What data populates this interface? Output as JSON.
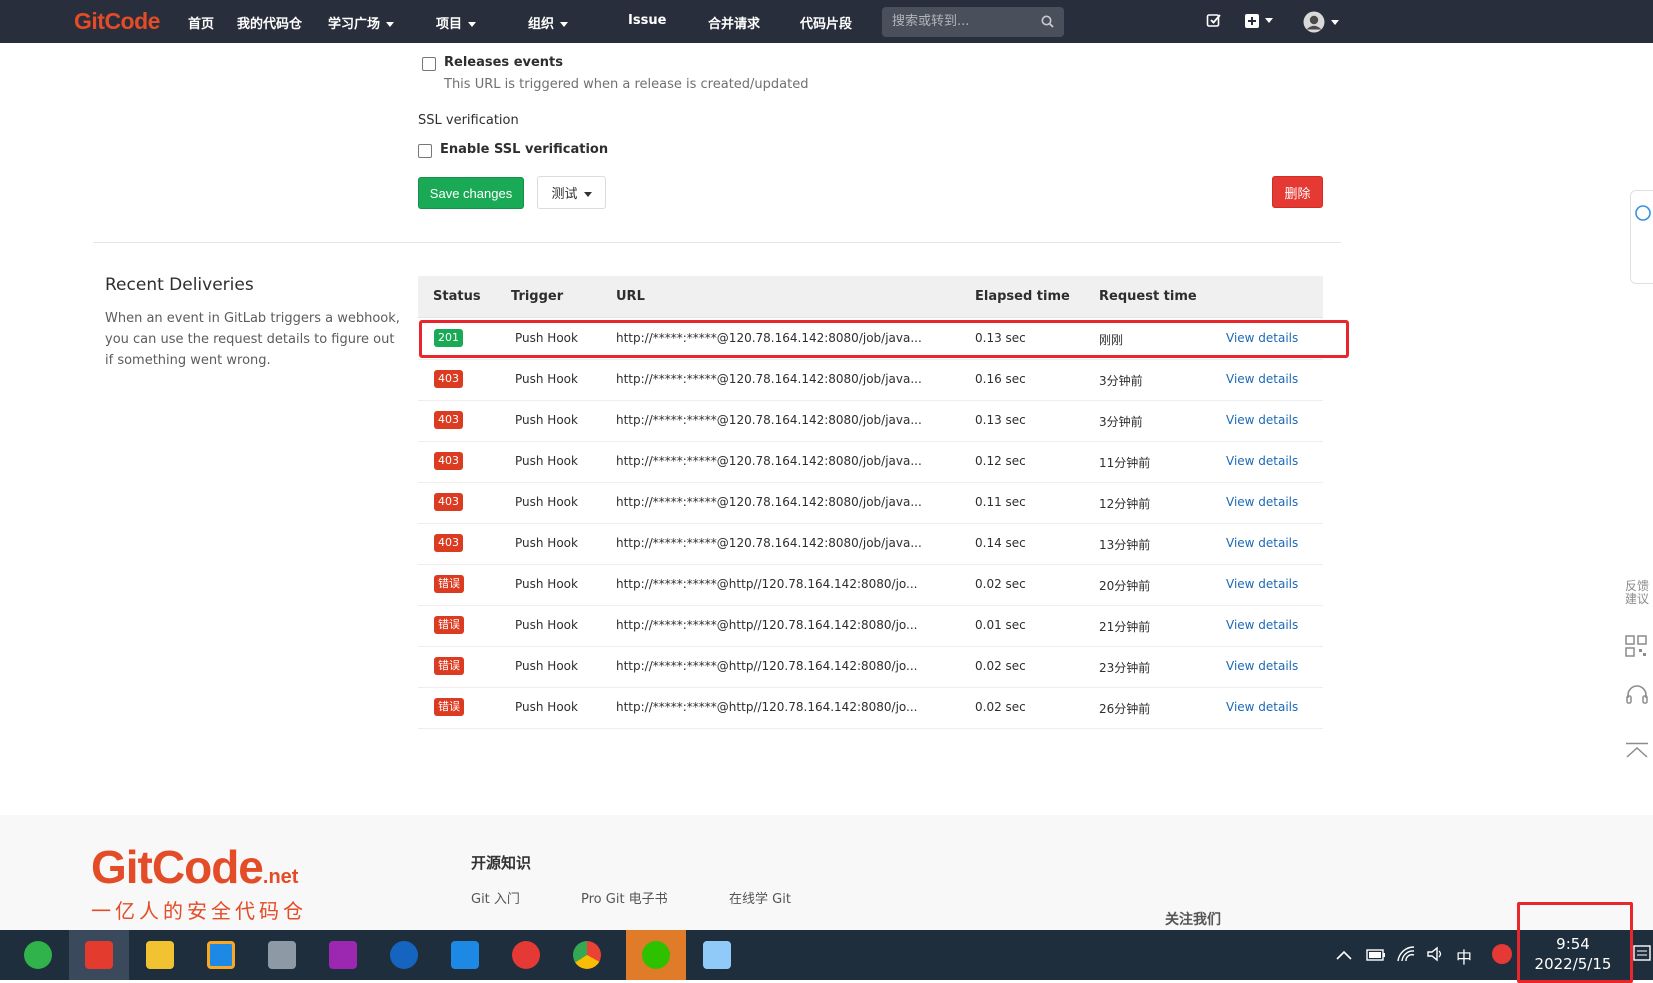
{
  "nav": {
    "logo": "GitCode",
    "items": [
      "首页",
      "我的代码仓",
      "学习广场",
      "项目",
      "组织",
      "Issue",
      "合并请求",
      "代码片段"
    ],
    "search_placeholder": "搜索或转到..."
  },
  "form": {
    "releases_label": "Releases events",
    "releases_help": "This URL is triggered when a release is created/updated",
    "ssl_heading": "SSL verification",
    "ssl_label": "Enable SSL verification",
    "save_button": "Save changes",
    "test_button": "测试",
    "delete_button": "删除"
  },
  "deliveries": {
    "title": "Recent Deliveries",
    "description_lines": [
      "When an event in GitLab triggers a webhook,",
      "you can use the request details to figure out",
      "if something went wrong."
    ],
    "columns": [
      "Status",
      "Trigger",
      "URL",
      "Elapsed time",
      "Request time"
    ],
    "rows": [
      {
        "status": "201",
        "kind": "success",
        "trigger": "Push Hook",
        "url": "http://*****:*****@120.78.164.142:8080/job/java...",
        "elapsed": "0.13 sec",
        "time": "刚刚",
        "action": "View details"
      },
      {
        "status": "403",
        "kind": "fail",
        "trigger": "Push Hook",
        "url": "http://*****:*****@120.78.164.142:8080/job/java...",
        "elapsed": "0.16 sec",
        "time": "3分钟前",
        "action": "View details"
      },
      {
        "status": "403",
        "kind": "fail",
        "trigger": "Push Hook",
        "url": "http://*****:*****@120.78.164.142:8080/job/java...",
        "elapsed": "0.13 sec",
        "time": "3分钟前",
        "action": "View details"
      },
      {
        "status": "403",
        "kind": "fail",
        "trigger": "Push Hook",
        "url": "http://*****:*****@120.78.164.142:8080/job/java...",
        "elapsed": "0.12 sec",
        "time": "11分钟前",
        "action": "View details"
      },
      {
        "status": "403",
        "kind": "fail",
        "trigger": "Push Hook",
        "url": "http://*****:*****@120.78.164.142:8080/job/java...",
        "elapsed": "0.11 sec",
        "time": "12分钟前",
        "action": "View details"
      },
      {
        "status": "403",
        "kind": "fail",
        "trigger": "Push Hook",
        "url": "http://*****:*****@120.78.164.142:8080/job/java...",
        "elapsed": "0.14 sec",
        "time": "13分钟前",
        "action": "View details"
      },
      {
        "status": "错误",
        "kind": "error",
        "trigger": "Push Hook",
        "url": "http://*****:*****@http//120.78.164.142:8080/jo...",
        "elapsed": "0.02 sec",
        "time": "20分钟前",
        "action": "View details"
      },
      {
        "status": "错误",
        "kind": "error",
        "trigger": "Push Hook",
        "url": "http://*****:*****@http//120.78.164.142:8080/jo...",
        "elapsed": "0.01 sec",
        "time": "21分钟前",
        "action": "View details"
      },
      {
        "status": "错误",
        "kind": "error",
        "trigger": "Push Hook",
        "url": "http://*****:*****@http//120.78.164.142:8080/jo...",
        "elapsed": "0.02 sec",
        "time": "23分钟前",
        "action": "View details"
      },
      {
        "status": "错误",
        "kind": "error",
        "trigger": "Push Hook",
        "url": "http://*****:*****@http//120.78.164.142:8080/jo...",
        "elapsed": "0.02 sec",
        "time": "26分钟前",
        "action": "View details"
      }
    ]
  },
  "footer": {
    "logo": "GitCode",
    "logo_suffix": ".net",
    "slogan": "一亿人的安全代码仓",
    "section_title": "开源知识",
    "links": [
      "Git 入门",
      "Pro Git 电子书",
      "在线学 Git"
    ],
    "follow": "关注我们"
  },
  "side": {
    "feedback": "反馈建议"
  },
  "taskbar": {
    "ime": "中",
    "time": "9:54",
    "date": "2022/5/15"
  },
  "colors": {
    "nav_bg": "#282e3b",
    "brand": "#e34c26",
    "success": "#1aaa55",
    "danger": "#db3b21",
    "link": "#1b69b6",
    "annotation": "#e8262b"
  }
}
